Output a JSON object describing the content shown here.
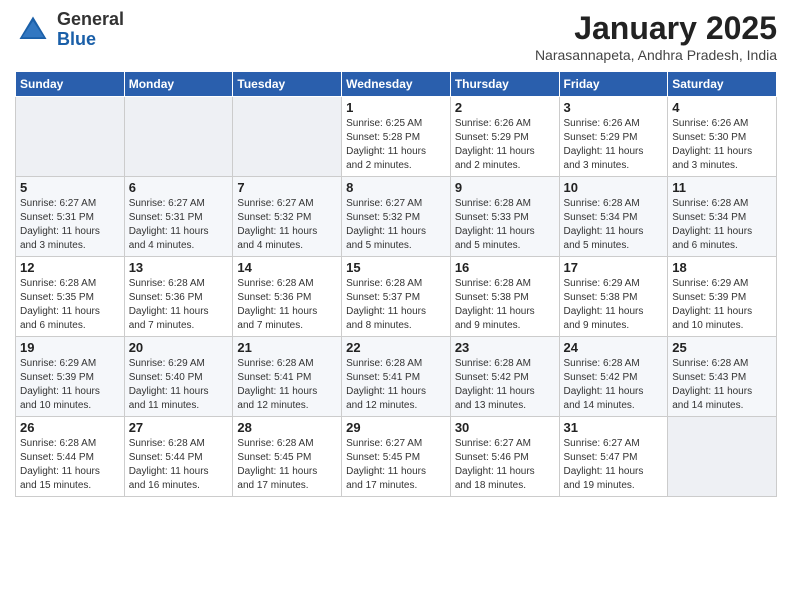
{
  "header": {
    "logo": {
      "general": "General",
      "blue": "Blue"
    },
    "title": "January 2025",
    "location": "Narasannapeta, Andhra Pradesh, India"
  },
  "days_of_week": [
    "Sunday",
    "Monday",
    "Tuesday",
    "Wednesday",
    "Thursday",
    "Friday",
    "Saturday"
  ],
  "weeks": [
    {
      "days": [
        {
          "num": "",
          "info": ""
        },
        {
          "num": "",
          "info": ""
        },
        {
          "num": "",
          "info": ""
        },
        {
          "num": "1",
          "info": "Sunrise: 6:25 AM\nSunset: 5:28 PM\nDaylight: 11 hours\nand 2 minutes."
        },
        {
          "num": "2",
          "info": "Sunrise: 6:26 AM\nSunset: 5:29 PM\nDaylight: 11 hours\nand 2 minutes."
        },
        {
          "num": "3",
          "info": "Sunrise: 6:26 AM\nSunset: 5:29 PM\nDaylight: 11 hours\nand 3 minutes."
        },
        {
          "num": "4",
          "info": "Sunrise: 6:26 AM\nSunset: 5:30 PM\nDaylight: 11 hours\nand 3 minutes."
        }
      ]
    },
    {
      "days": [
        {
          "num": "5",
          "info": "Sunrise: 6:27 AM\nSunset: 5:31 PM\nDaylight: 11 hours\nand 3 minutes."
        },
        {
          "num": "6",
          "info": "Sunrise: 6:27 AM\nSunset: 5:31 PM\nDaylight: 11 hours\nand 4 minutes."
        },
        {
          "num": "7",
          "info": "Sunrise: 6:27 AM\nSunset: 5:32 PM\nDaylight: 11 hours\nand 4 minutes."
        },
        {
          "num": "8",
          "info": "Sunrise: 6:27 AM\nSunset: 5:32 PM\nDaylight: 11 hours\nand 5 minutes."
        },
        {
          "num": "9",
          "info": "Sunrise: 6:28 AM\nSunset: 5:33 PM\nDaylight: 11 hours\nand 5 minutes."
        },
        {
          "num": "10",
          "info": "Sunrise: 6:28 AM\nSunset: 5:34 PM\nDaylight: 11 hours\nand 5 minutes."
        },
        {
          "num": "11",
          "info": "Sunrise: 6:28 AM\nSunset: 5:34 PM\nDaylight: 11 hours\nand 6 minutes."
        }
      ]
    },
    {
      "days": [
        {
          "num": "12",
          "info": "Sunrise: 6:28 AM\nSunset: 5:35 PM\nDaylight: 11 hours\nand 6 minutes."
        },
        {
          "num": "13",
          "info": "Sunrise: 6:28 AM\nSunset: 5:36 PM\nDaylight: 11 hours\nand 7 minutes."
        },
        {
          "num": "14",
          "info": "Sunrise: 6:28 AM\nSunset: 5:36 PM\nDaylight: 11 hours\nand 7 minutes."
        },
        {
          "num": "15",
          "info": "Sunrise: 6:28 AM\nSunset: 5:37 PM\nDaylight: 11 hours\nand 8 minutes."
        },
        {
          "num": "16",
          "info": "Sunrise: 6:28 AM\nSunset: 5:38 PM\nDaylight: 11 hours\nand 9 minutes."
        },
        {
          "num": "17",
          "info": "Sunrise: 6:29 AM\nSunset: 5:38 PM\nDaylight: 11 hours\nand 9 minutes."
        },
        {
          "num": "18",
          "info": "Sunrise: 6:29 AM\nSunset: 5:39 PM\nDaylight: 11 hours\nand 10 minutes."
        }
      ]
    },
    {
      "days": [
        {
          "num": "19",
          "info": "Sunrise: 6:29 AM\nSunset: 5:39 PM\nDaylight: 11 hours\nand 10 minutes."
        },
        {
          "num": "20",
          "info": "Sunrise: 6:29 AM\nSunset: 5:40 PM\nDaylight: 11 hours\nand 11 minutes."
        },
        {
          "num": "21",
          "info": "Sunrise: 6:28 AM\nSunset: 5:41 PM\nDaylight: 11 hours\nand 12 minutes."
        },
        {
          "num": "22",
          "info": "Sunrise: 6:28 AM\nSunset: 5:41 PM\nDaylight: 11 hours\nand 12 minutes."
        },
        {
          "num": "23",
          "info": "Sunrise: 6:28 AM\nSunset: 5:42 PM\nDaylight: 11 hours\nand 13 minutes."
        },
        {
          "num": "24",
          "info": "Sunrise: 6:28 AM\nSunset: 5:42 PM\nDaylight: 11 hours\nand 14 minutes."
        },
        {
          "num": "25",
          "info": "Sunrise: 6:28 AM\nSunset: 5:43 PM\nDaylight: 11 hours\nand 14 minutes."
        }
      ]
    },
    {
      "days": [
        {
          "num": "26",
          "info": "Sunrise: 6:28 AM\nSunset: 5:44 PM\nDaylight: 11 hours\nand 15 minutes."
        },
        {
          "num": "27",
          "info": "Sunrise: 6:28 AM\nSunset: 5:44 PM\nDaylight: 11 hours\nand 16 minutes."
        },
        {
          "num": "28",
          "info": "Sunrise: 6:28 AM\nSunset: 5:45 PM\nDaylight: 11 hours\nand 17 minutes."
        },
        {
          "num": "29",
          "info": "Sunrise: 6:27 AM\nSunset: 5:45 PM\nDaylight: 11 hours\nand 17 minutes."
        },
        {
          "num": "30",
          "info": "Sunrise: 6:27 AM\nSunset: 5:46 PM\nDaylight: 11 hours\nand 18 minutes."
        },
        {
          "num": "31",
          "info": "Sunrise: 6:27 AM\nSunset: 5:47 PM\nDaylight: 11 hours\nand 19 minutes."
        },
        {
          "num": "",
          "info": ""
        }
      ]
    }
  ]
}
